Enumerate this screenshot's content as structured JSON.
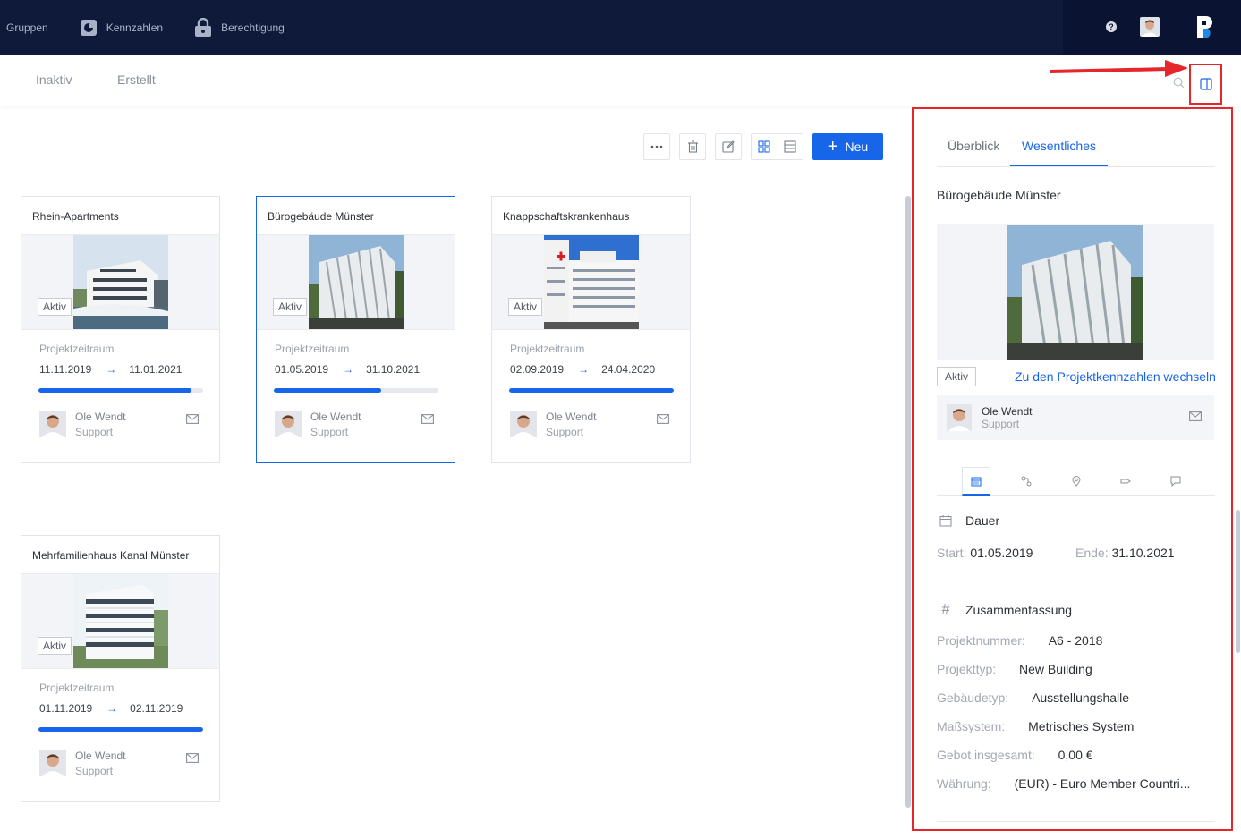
{
  "topbar": {
    "nav": [
      {
        "label": "Gruppen",
        "icon": "none"
      },
      {
        "label": "Kennzahlen",
        "icon": "chart-pie-icon"
      },
      {
        "label": "Berechtigung",
        "icon": "lock-icon"
      }
    ],
    "help": "?"
  },
  "subbar": {
    "tabs": [
      "Inaktiv",
      "Erstellt"
    ]
  },
  "toolbar": {
    "new_label": "Neu"
  },
  "cards": [
    {
      "title": "Rhein-Apartments",
      "status": "Aktiv",
      "period_label": "Projektzeitraum",
      "start": "11.11.2019",
      "end": "11.01.2021",
      "progress": 0.93,
      "person": "Ole Wendt",
      "role": "Support",
      "selected": false
    },
    {
      "title": "Bürogebäude Münster",
      "status": "Aktiv",
      "period_label": "Projektzeitraum",
      "start": "01.05.2019",
      "end": "31.10.2021",
      "progress": 0.65,
      "person": "Ole Wendt",
      "role": "Support",
      "selected": true
    },
    {
      "title": "Knappschaftskrankenhaus",
      "status": "Aktiv",
      "period_label": "Projektzeitraum",
      "start": "02.09.2019",
      "end": "24.04.2020",
      "progress": 1.0,
      "person": "Ole Wendt",
      "role": "Support",
      "selected": false
    },
    {
      "title": "Mehrfamilienhaus Kanal Münster",
      "status": "Aktiv",
      "period_label": "Projektzeitraum",
      "start": "01.11.2019",
      "end": "02.11.2019",
      "progress": 1.0,
      "person": "Ole Wendt",
      "role": "Support",
      "selected": false
    }
  ],
  "panel": {
    "tabs": [
      "Überblick",
      "Wesentliches"
    ],
    "active_tab": "Wesentliches",
    "title": "Bürogebäude Münster",
    "status": "Aktiv",
    "link": "Zu den Projektkennzahlen wechseln",
    "person": {
      "name": "Ole Wendt",
      "role": "Support"
    },
    "icon_tabs": [
      "calendar-icon",
      "connection-icon",
      "location-pin-icon",
      "tag-icon",
      "comment-icon"
    ],
    "duration": {
      "heading": "Dauer",
      "start_label": "Start:",
      "start": "01.05.2019",
      "end_label": "Ende:",
      "end": "31.10.2021"
    },
    "summary": {
      "heading": "Zusammenfassung",
      "rows": [
        {
          "k": "Projektnummer:",
          "v": "A6 - 2018"
        },
        {
          "k": "Projekttyp:",
          "v": "New Building"
        },
        {
          "k": "Gebäudetyp:",
          "v": "Ausstellungshalle"
        },
        {
          "k": "Maßsystem:",
          "v": "Metrisches System"
        },
        {
          "k": "Gebot insgesamt:",
          "v": "0,00 €"
        },
        {
          "k": "Währung:",
          "v": "(EUR) - Euro Member Countri..."
        }
      ]
    }
  },
  "colors": {
    "accent": "#1765e8",
    "topbar": "#0f1a3a",
    "annotation": "#e5262b"
  }
}
